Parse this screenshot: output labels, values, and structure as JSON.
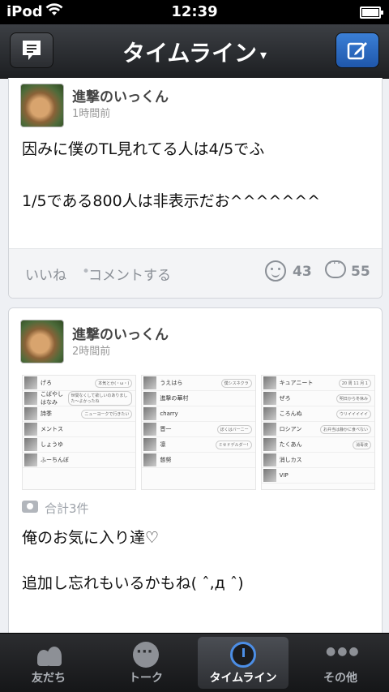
{
  "status_bar": {
    "carrier": "iPod",
    "time": "12:39"
  },
  "nav": {
    "title": "タイムライン",
    "caret": "▾"
  },
  "posts": [
    {
      "author": "進撃のいっくん",
      "time": "1時間前",
      "lines": [
        "因みに僕のTL見れてる人は4/5でふ",
        "",
        "1/5である800人は非表示だお^^^^^^^"
      ],
      "like_label": "いいね",
      "separator": "•",
      "comment_label": "コメントする",
      "smile_count": "43",
      "comment_count": "55"
    },
    {
      "author": "進撃のいっくん",
      "time": "2時間前",
      "photo_total": "合計3件",
      "lines": [
        "俺のお気に入り達♡",
        "",
        "追加し忘れもいるかもね( ˆ,д ˆ)"
      ],
      "screenshots": [
        [
          "げろ",
          "こばやしはなみ",
          "詩季",
          "メントス",
          "しょうゆ",
          "ふーちんぼ"
        ],
        [
          "うえはら",
          "進撃の華村",
          "charry",
          "晋一",
          "凛",
          "慈努"
        ],
        [
          "キュアニート",
          "ぜろ",
          "ころんぬ",
          "ロシアン",
          "たくあん",
          "消しカス",
          "VIP"
        ]
      ],
      "bubbles": [
        "本気とか(・ω・)",
        "ニューヨークで行きたい",
        "世間なくして欲しいのありました～よかったね",
        "僕シスネクラ",
        "ぼくはバーニー",
        "ミセドデルダー!",
        "ウリイイイイイ",
        "明日から冬休み",
        "お弁当は静かに食べない",
        "消毒液",
        "20 周 11 月 1"
      ]
    }
  ],
  "tabs": [
    {
      "label": "友だち",
      "icon": "friends-icon"
    },
    {
      "label": "トーク",
      "icon": "talk-icon"
    },
    {
      "label": "タイムライン",
      "icon": "timeline-clock-icon"
    },
    {
      "label": "その他",
      "icon": "more-icon"
    }
  ]
}
